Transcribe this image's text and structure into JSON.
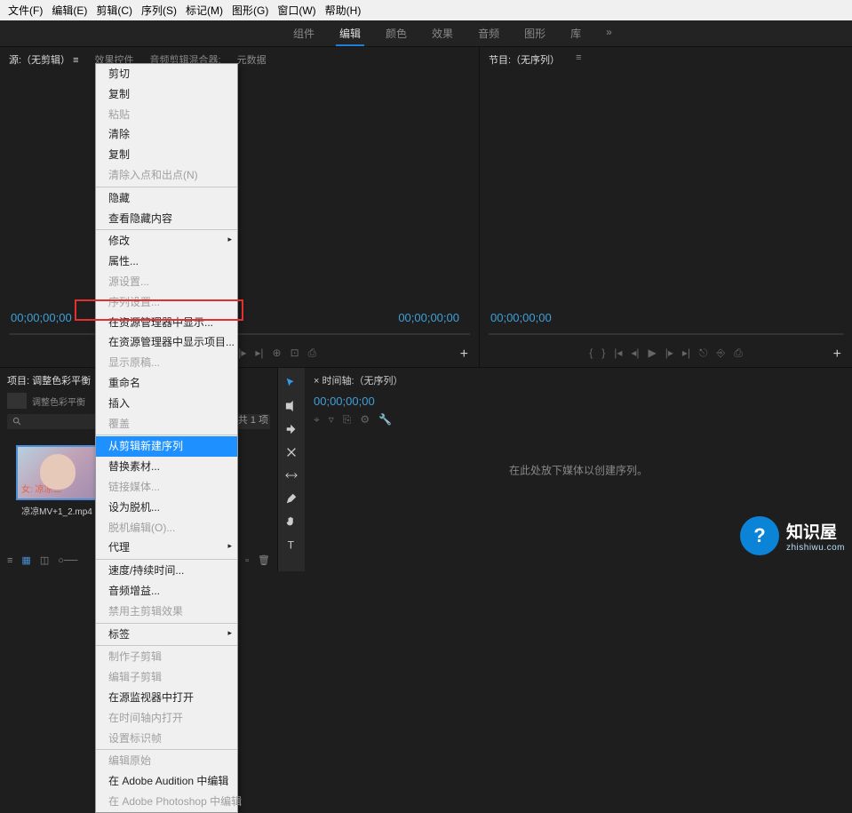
{
  "menubar": [
    "文件(F)",
    "编辑(E)",
    "剪辑(C)",
    "序列(S)",
    "标记(M)",
    "图形(G)",
    "窗口(W)",
    "帮助(H)"
  ],
  "workspace": {
    "items": [
      "组件",
      "编辑",
      "颜色",
      "效果",
      "音频",
      "图形",
      "库"
    ],
    "more": "»"
  },
  "source": {
    "tabs": [
      "源:（无剪辑）",
      "效果控件",
      "音频剪辑混合器:",
      "元数据"
    ],
    "tc_left": "00;00;00;00",
    "tc_right": "00;00;00;00"
  },
  "program": {
    "tab": "节目:（无序列）",
    "tc_left": "00;00;00;00"
  },
  "project": {
    "tab": "项目: 调整色彩平衡",
    "bin_label": "调整色彩平衡",
    "item_count": "共 1 项",
    "clip_name": "凉凉MV+1_2.mp4"
  },
  "timeline": {
    "tab": "× 时间轴:（无序列）",
    "tc": "00;00;00;00",
    "empty": "在此处放下媒体以创建序列。"
  },
  "context_menu": [
    {
      "t": "剪切"
    },
    {
      "t": "复制"
    },
    {
      "t": "粘贴",
      "d": true
    },
    {
      "t": "清除"
    },
    {
      "t": "复制"
    },
    {
      "t": "清除入点和出点(N)",
      "d": true
    },
    {
      "sep": true
    },
    {
      "t": "隐藏"
    },
    {
      "t": "查看隐藏内容"
    },
    {
      "sep": true
    },
    {
      "t": "修改",
      "sub": true
    },
    {
      "t": "属性..."
    },
    {
      "t": "源设置...",
      "d": true
    },
    {
      "t": "序列设置...",
      "d": true
    },
    {
      "t": "在资源管理器中显示..."
    },
    {
      "t": "在资源管理器中显示项目..."
    },
    {
      "t": "显示原稿...",
      "d": true
    },
    {
      "t": "重命名"
    },
    {
      "t": "插入"
    },
    {
      "t": "覆盖",
      "d": true
    },
    {
      "sep": true
    },
    {
      "t": "从剪辑新建序列",
      "hl": true
    },
    {
      "t": "替换素材..."
    },
    {
      "t": "链接媒体...",
      "d": true
    },
    {
      "t": "设为脱机..."
    },
    {
      "t": "脱机编辑(O)...",
      "d": true
    },
    {
      "t": "代理",
      "sub": true
    },
    {
      "sep": true
    },
    {
      "t": "速度/持续时间..."
    },
    {
      "t": "音频增益..."
    },
    {
      "t": "禁用主剪辑效果",
      "d": true
    },
    {
      "sep": true
    },
    {
      "t": "标签",
      "sub": true
    },
    {
      "sep": true
    },
    {
      "t": "制作子剪辑",
      "d": true
    },
    {
      "t": "编辑子剪辑",
      "d": true
    },
    {
      "t": "在源监视器中打开"
    },
    {
      "t": "在时间轴内打开",
      "d": true
    },
    {
      "t": "设置标识帧",
      "d": true
    },
    {
      "sep": true
    },
    {
      "t": "编辑原始",
      "d": true
    },
    {
      "t": "在 Adobe Audition 中编辑"
    },
    {
      "t": "在 Adobe Photoshop 中编辑",
      "d": true
    }
  ],
  "watermark": {
    "symbol": "?",
    "title": "知识屋",
    "url": "zhishiwu.com"
  }
}
